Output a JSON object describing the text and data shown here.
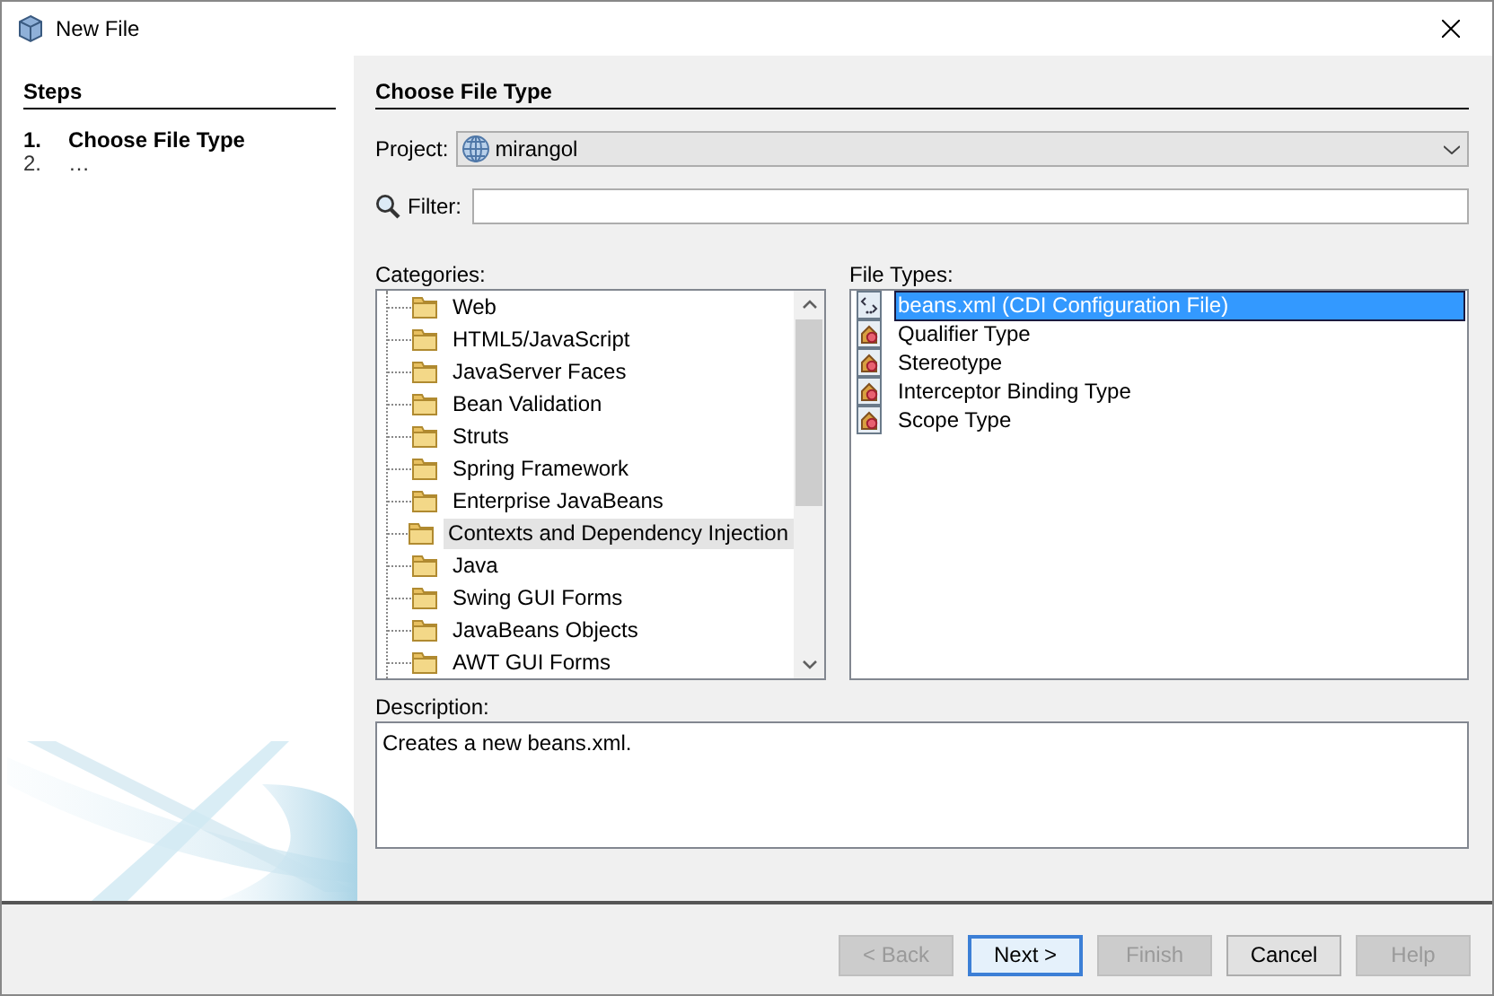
{
  "window": {
    "title": "New File"
  },
  "steps": {
    "title": "Steps",
    "items": [
      {
        "number": "1.",
        "label": "Choose File Type",
        "selected": true
      },
      {
        "number": "2.",
        "label": "…",
        "selected": false
      }
    ]
  },
  "panel": {
    "title": "Choose File Type",
    "project": {
      "label": "Project:",
      "value": "mirangol"
    },
    "filter": {
      "label": "Filter:"
    },
    "categories": {
      "label": "Categories:",
      "items": [
        {
          "label": "Web",
          "selected": false
        },
        {
          "label": "HTML5/JavaScript",
          "selected": false
        },
        {
          "label": "JavaServer Faces",
          "selected": false
        },
        {
          "label": "Bean Validation",
          "selected": false
        },
        {
          "label": "Struts",
          "selected": false
        },
        {
          "label": "Spring Framework",
          "selected": false
        },
        {
          "label": "Enterprise JavaBeans",
          "selected": false
        },
        {
          "label": "Contexts and Dependency Injection",
          "selected": true
        },
        {
          "label": "Java",
          "selected": false
        },
        {
          "label": "Swing GUI Forms",
          "selected": false
        },
        {
          "label": "JavaBeans Objects",
          "selected": false
        },
        {
          "label": "AWT GUI Forms",
          "selected": false
        }
      ]
    },
    "file_types": {
      "label": "File Types:",
      "items": [
        {
          "label": "beans.xml (CDI Configuration File)",
          "kind": "xml",
          "selected": true
        },
        {
          "label": "Qualifier Type",
          "kind": "class",
          "selected": false
        },
        {
          "label": "Stereotype",
          "kind": "class",
          "selected": false
        },
        {
          "label": "Interceptor Binding Type",
          "kind": "class",
          "selected": false
        },
        {
          "label": "Scope Type",
          "kind": "class",
          "selected": false
        }
      ]
    },
    "description": {
      "label": "Description:",
      "value": "Creates a new beans.xml."
    }
  },
  "buttons": [
    {
      "label": "< Back",
      "disabled": true,
      "default": false
    },
    {
      "label": "Next >",
      "disabled": false,
      "default": true
    },
    {
      "label": "Finish",
      "disabled": true,
      "default": false
    },
    {
      "label": "Cancel",
      "disabled": false,
      "default": false
    },
    {
      "label": "Help",
      "disabled": true,
      "default": false
    }
  ]
}
